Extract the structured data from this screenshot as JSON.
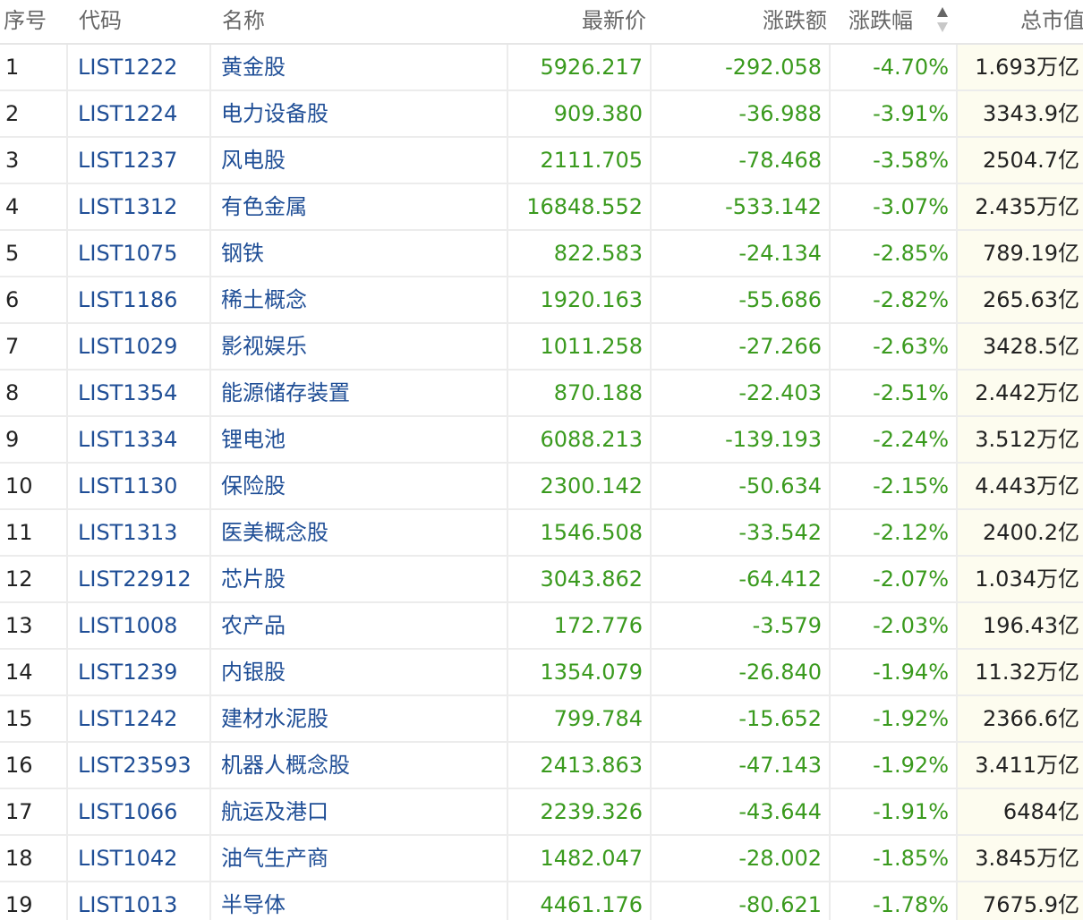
{
  "colors": {
    "down_green": "#3a9a1e",
    "link_blue": "#1f4e96",
    "header_text": "#666666",
    "market_cap_bg": "#fdfcef"
  },
  "header": {
    "index": "序号",
    "code": "代码",
    "name": "名称",
    "price": "最新价",
    "change": "涨跌额",
    "change_pct": "涨跌幅",
    "market_cap": "总市值",
    "sort_icon": "sort-descending-icon"
  },
  "rows": [
    {
      "index": "1",
      "code": "LIST1222",
      "name": "黄金股",
      "price": "5926.217",
      "change": "-292.058",
      "change_pct": "-4.70%",
      "market_cap": "1.693万亿"
    },
    {
      "index": "2",
      "code": "LIST1224",
      "name": "电力设备股",
      "price": "909.380",
      "change": "-36.988",
      "change_pct": "-3.91%",
      "market_cap": "3343.9亿"
    },
    {
      "index": "3",
      "code": "LIST1237",
      "name": "风电股",
      "price": "2111.705",
      "change": "-78.468",
      "change_pct": "-3.58%",
      "market_cap": "2504.7亿"
    },
    {
      "index": "4",
      "code": "LIST1312",
      "name": "有色金属",
      "price": "16848.552",
      "change": "-533.142",
      "change_pct": "-3.07%",
      "market_cap": "2.435万亿"
    },
    {
      "index": "5",
      "code": "LIST1075",
      "name": "钢铁",
      "price": "822.583",
      "change": "-24.134",
      "change_pct": "-2.85%",
      "market_cap": "789.19亿"
    },
    {
      "index": "6",
      "code": "LIST1186",
      "name": "稀土概念",
      "price": "1920.163",
      "change": "-55.686",
      "change_pct": "-2.82%",
      "market_cap": "265.63亿"
    },
    {
      "index": "7",
      "code": "LIST1029",
      "name": "影视娱乐",
      "price": "1011.258",
      "change": "-27.266",
      "change_pct": "-2.63%",
      "market_cap": "3428.5亿"
    },
    {
      "index": "8",
      "code": "LIST1354",
      "name": "能源储存装置",
      "price": "870.188",
      "change": "-22.403",
      "change_pct": "-2.51%",
      "market_cap": "2.442万亿"
    },
    {
      "index": "9",
      "code": "LIST1334",
      "name": "锂电池",
      "price": "6088.213",
      "change": "-139.193",
      "change_pct": "-2.24%",
      "market_cap": "3.512万亿"
    },
    {
      "index": "10",
      "code": "LIST1130",
      "name": "保险股",
      "price": "2300.142",
      "change": "-50.634",
      "change_pct": "-2.15%",
      "market_cap": "4.443万亿"
    },
    {
      "index": "11",
      "code": "LIST1313",
      "name": "医美概念股",
      "price": "1546.508",
      "change": "-33.542",
      "change_pct": "-2.12%",
      "market_cap": "2400.2亿"
    },
    {
      "index": "12",
      "code": "LIST22912",
      "name": "芯片股",
      "price": "3043.862",
      "change": "-64.412",
      "change_pct": "-2.07%",
      "market_cap": "1.034万亿"
    },
    {
      "index": "13",
      "code": "LIST1008",
      "name": "农产品",
      "price": "172.776",
      "change": "-3.579",
      "change_pct": "-2.03%",
      "market_cap": "196.43亿"
    },
    {
      "index": "14",
      "code": "LIST1239",
      "name": "内银股",
      "price": "1354.079",
      "change": "-26.840",
      "change_pct": "-1.94%",
      "market_cap": "11.32万亿"
    },
    {
      "index": "15",
      "code": "LIST1242",
      "name": "建材水泥股",
      "price": "799.784",
      "change": "-15.652",
      "change_pct": "-1.92%",
      "market_cap": "2366.6亿"
    },
    {
      "index": "16",
      "code": "LIST23593",
      "name": "机器人概念股",
      "price": "2413.863",
      "change": "-47.143",
      "change_pct": "-1.92%",
      "market_cap": "3.411万亿"
    },
    {
      "index": "17",
      "code": "LIST1066",
      "name": "航运及港口",
      "price": "2239.326",
      "change": "-43.644",
      "change_pct": "-1.91%",
      "market_cap": "6484亿"
    },
    {
      "index": "18",
      "code": "LIST1042",
      "name": "油气生产商",
      "price": "1482.047",
      "change": "-28.002",
      "change_pct": "-1.85%",
      "market_cap": "3.845万亿"
    },
    {
      "index": "19",
      "code": "LIST1013",
      "name": "半导体",
      "price": "4461.176",
      "change": "-80.621",
      "change_pct": "-1.78%",
      "market_cap": "7675.9亿"
    }
  ]
}
